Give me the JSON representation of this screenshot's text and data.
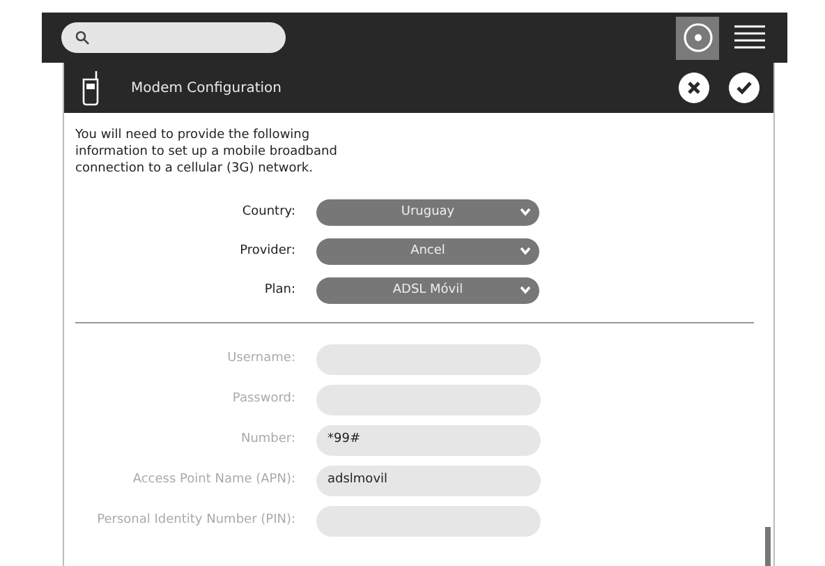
{
  "toolbar": {
    "buttons": [
      {
        "kind": "circle",
        "selected": true
      },
      {
        "kind": "lines",
        "selected": false
      }
    ]
  },
  "dialog": {
    "title": "Modem Configuration",
    "intro": "You will need to provide the following information to set up a mobile broadband connection to a cellular (3G) network.",
    "selects": [
      {
        "label": "Country:",
        "value": "Uruguay"
      },
      {
        "label": "Provider:",
        "value": "Ancel"
      },
      {
        "label": "Plan:",
        "value": "ADSL Móvil"
      }
    ],
    "fields": [
      {
        "label": "Username:"
      },
      {
        "label": "Password:"
      },
      {
        "label": "Number:",
        "value": "*99#"
      },
      {
        "label": "Access Point Name (APN):",
        "value": "adslmovil"
      },
      {
        "label": "Personal Identity Number (PIN):"
      }
    ]
  }
}
